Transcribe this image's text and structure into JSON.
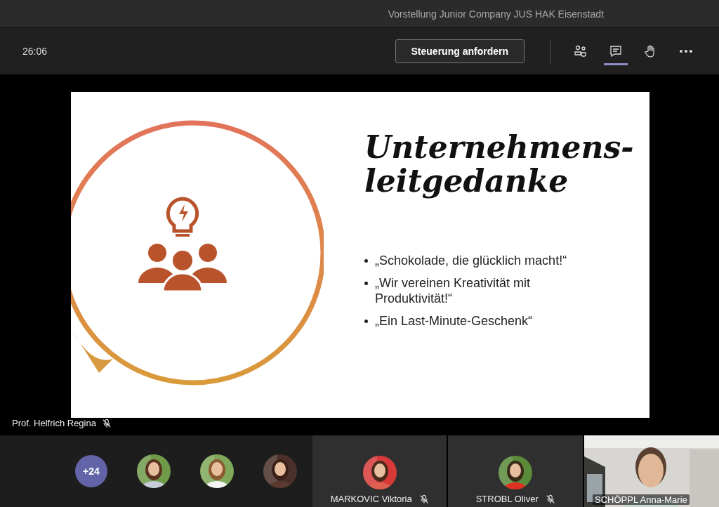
{
  "meeting": {
    "title": "Vorstellung Junior Company JUS HAK Eisenstadt"
  },
  "toolbar": {
    "timer": "26:06",
    "request_button": "Steuerung anfordern",
    "buttons": [
      {
        "kind": "people",
        "selected": false
      },
      {
        "kind": "chat",
        "selected": true
      },
      {
        "kind": "hand",
        "selected": false
      },
      {
        "kind": "more",
        "selected": false
      }
    ]
  },
  "slide": {
    "title_lines": [
      "Unternehmens-",
      "leitgedanke"
    ],
    "bullets": [
      "„Schokolade, die glücklich macht!“",
      "„Wir vereinen Kreativität mit Produktivität!“",
      "„Ein Last-Minute-Geschenk“"
    ]
  },
  "presenter": {
    "name": "Prof. Helfrich Regina",
    "muted": true
  },
  "overflow": {
    "count": "+24"
  },
  "participants": [
    {
      "kind": "avatar"
    },
    {
      "kind": "avatar"
    },
    {
      "kind": "avatar"
    },
    {
      "kind": "named",
      "name": "MARKOVIC Viktoria",
      "muted": true
    },
    {
      "kind": "named",
      "name": "STROBL Oliver",
      "muted": true
    },
    {
      "kind": "video",
      "name": "SCHÖPPL Anna-Marie"
    }
  ]
}
